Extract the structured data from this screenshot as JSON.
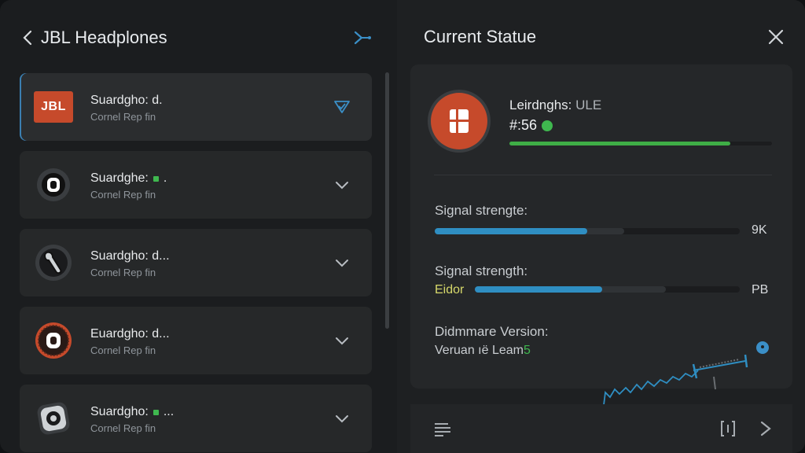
{
  "left": {
    "title": "JBL Headplones",
    "devices": [
      {
        "title": "Suardgho: d.",
        "subtitle": "Cornel Rep fin",
        "active": true,
        "badge": false,
        "icon": "jbl-logo"
      },
      {
        "title": "Suardghe: ",
        "subtitle": "Cornel Rep fin",
        "active": false,
        "badge": true,
        "title_suffix": ".",
        "icon": "ring-device-icon"
      },
      {
        "title": "Suardgho: d...",
        "subtitle": "Cornel Rep fin",
        "active": false,
        "badge": false,
        "icon": "earbud-icon"
      },
      {
        "title": "Euardgho: d...",
        "subtitle": "Cornel Rep fin",
        "active": false,
        "badge": false,
        "icon": "ring-orange-icon"
      },
      {
        "title": "Suardgho: ",
        "subtitle": "Cornel Rep fin",
        "active": false,
        "badge": true,
        "title_suffix": "...",
        "icon": "gear-device-icon"
      }
    ],
    "logo_text": "JBL"
  },
  "right": {
    "title": "Current Statue",
    "battery": {
      "label": "Leirdnghs:",
      "label_suffix": "ULE",
      "value": "#:56",
      "fill_pct": 84
    },
    "signal1": {
      "label": "Signal strengte:",
      "value": "9K",
      "fill_pct": 50,
      "buffer_pct": 62
    },
    "signal2": {
      "label": "Signal strength:",
      "prefix": "Eidor",
      "value": "PB",
      "fill_pct": 48,
      "buffer_pct": 72
    },
    "firmware": {
      "label": "Didmmare Version:",
      "value": "Veruan ıë Leam",
      "value_suffix": "5"
    }
  },
  "colors": {
    "accent_blue": "#2f8ec2",
    "green": "#3fb84f",
    "jbl_orange": "#c64a2b"
  }
}
